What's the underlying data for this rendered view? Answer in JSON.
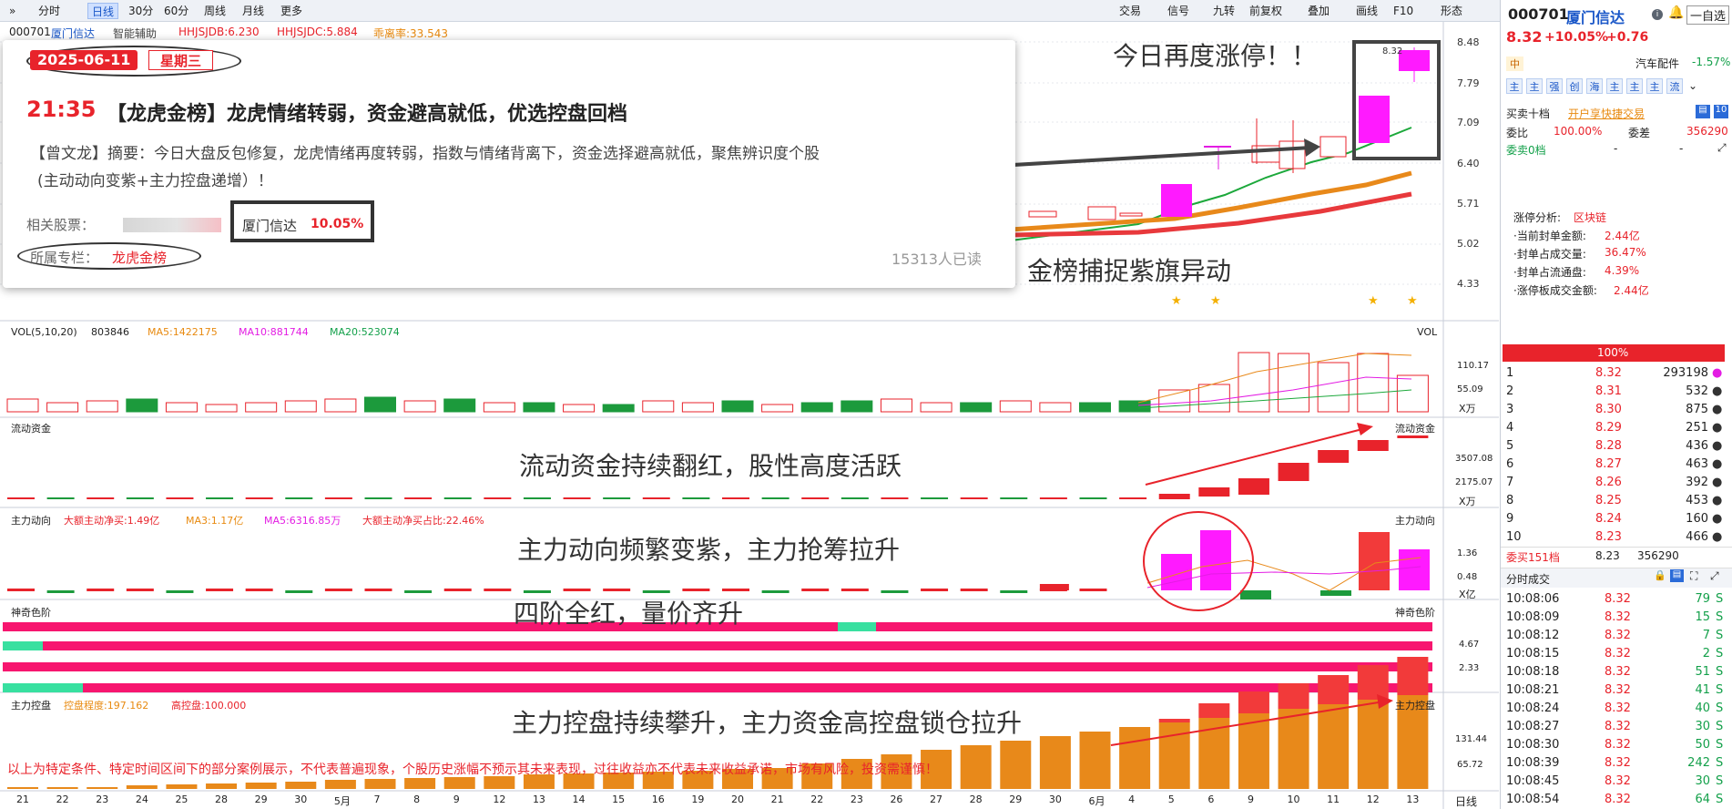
{
  "toolbar": {
    "items": [
      "»",
      "分时",
      "日线",
      "30分",
      "60分",
      "周线",
      "月线",
      "更多",
      "交易",
      "信号",
      "九转",
      "前复权",
      "叠加",
      "画线",
      "F10",
      "形态"
    ]
  },
  "header": {
    "code": "000701",
    "name": "厦门信达",
    "ind1": "HHJSJDB:6.230",
    "ind2": "HHJSJDC:5.884",
    "ind3": "乖离率:33.543",
    "assist": "智能辅助"
  },
  "price_axis": [
    "8.48",
    "7.79",
    "7.09",
    "6.40",
    "5.71",
    "5.02",
    "4.33"
  ],
  "news": {
    "date": "2025-06-11",
    "weekday": "星期三",
    "time": "21:35",
    "title": "【龙虎金榜】龙虎情绪转弱，资金避高就低，优选控盘回档",
    "summary1": "【曾文龙】摘要：今日大盘反包修复，龙虎情绪再度转弱，指数与情绪背离下，资金选择避高就低，聚焦辨识度个股",
    "summary2": "(主动动向变紫+主力控盘递增）！",
    "related_label": "相关股票：",
    "stock": "厦门信达",
    "stock_pct": "10.05%",
    "column_label": "所属专栏：",
    "column": "龙虎金榜",
    "reads": "15313人已读"
  },
  "annotations": {
    "a1": "今日再度涨停！！",
    "a2": "金榜捕捉紫旗异动",
    "a3": "流动资金持续翻红，股性高度活跃",
    "a4": "主力动向频繁变紫，主力抢筹拉升",
    "a5": "四阶全红，量价齐升",
    "a6": "主力控盘持续攀升，主力资金高控盘锁仓拉升",
    "disclaimer": "以上为特定条件、特定时间区间下的部分案例展示，不代表普遍现象，个股历史涨幅不预示其未来表现，过往收益亦不代表未来收益承诺，市场有风险，投资需谨慎！"
  },
  "vol": {
    "title": "VOL(5,10,20)",
    "val": "803846",
    "ma5": "MA5:1422175",
    "ma10": "MA10:881744",
    "ma20": "MA20:523074",
    "tag": "VOL",
    "axis": [
      "110.17",
      "55.09"
    ],
    "unit": "X万"
  },
  "flow": {
    "title": "流动资金",
    "tag": "流动资金",
    "axis": [
      "3507.08",
      "2175.07"
    ],
    "unit": "X万"
  },
  "main": {
    "title": "主力动向",
    "big": "大额主动净买:1.49亿",
    "ma3": "MA3:1.17亿",
    "ma5": "MA5:6316.85万",
    "ratio": "大额主动净买占比:22.46%",
    "tag": "主力动向",
    "axis": [
      "1.36",
      "0.48"
    ],
    "unit": "X亿"
  },
  "magic": {
    "title": "神奇色阶",
    "tag": "神奇色阶",
    "axis": [
      "4.67",
      "2.33"
    ]
  },
  "ctrl": {
    "title": "主力控盘",
    "deg": "控盘程度:197.162",
    "high": "高控盘:100.000",
    "tag": "主力控盘",
    "axis": [
      "131.44",
      "65.72"
    ]
  },
  "xaxis": [
    "21",
    "22",
    "23",
    "24",
    "25",
    "28",
    "29",
    "30",
    "5月",
    "7",
    "8",
    "9",
    "12",
    "13",
    "14",
    "15",
    "16",
    "19",
    "20",
    "21",
    "22",
    "23",
    "26",
    "27",
    "28",
    "29",
    "30",
    "6月",
    "4",
    "5",
    "6",
    "9",
    "10",
    "11",
    "12",
    "13"
  ],
  "xaxis_tag": "日线",
  "right": {
    "code": "000701",
    "name": "厦门信达",
    "price": "8.32",
    "pct": "+10.05%",
    "chg": "+0.76",
    "self": "一自选",
    "sector_tag": "中",
    "sector": "汽车配件",
    "sector_pct": "-1.57%",
    "tabs": [
      "主",
      "主",
      "强",
      "创",
      "海",
      "主",
      "主",
      "主",
      "流"
    ],
    "l10": "买卖十档",
    "open_btn": "开户享快捷交易",
    "wb_label": "委比",
    "wb": "100.00%",
    "wc_label": "委差",
    "wc": "356290",
    "ws0": "委卖0档",
    "ws_dash": "-",
    "ws_dash2": "-",
    "limit_title": "涨停分析:",
    "limit_val": "区块链",
    "seal_amt": "·当前封单金额:",
    "seal_amt_v": "2.44亿",
    "seal_vol": "·封单占成交量:",
    "seal_vol_v": "36.47%",
    "seal_flow": "·封单占流通盘:",
    "seal_flow_v": "4.39%",
    "limit_amt": "·涨停板成交金额:",
    "limit_amt_v": "2.44亿",
    "pct100": "100%",
    "book": [
      [
        "1",
        "8.32",
        "293198"
      ],
      [
        "2",
        "8.31",
        "532"
      ],
      [
        "3",
        "8.30",
        "875"
      ],
      [
        "4",
        "8.29",
        "251"
      ],
      [
        "5",
        "8.28",
        "436"
      ],
      [
        "6",
        "8.27",
        "463"
      ],
      [
        "7",
        "8.26",
        "392"
      ],
      [
        "8",
        "8.25",
        "453"
      ],
      [
        "9",
        "8.24",
        "160"
      ],
      [
        "10",
        "8.23",
        "466"
      ]
    ],
    "wm_label": "委买151档",
    "wm_price": "8.23",
    "wm_vol": "356290",
    "ticks_title": "分时成交",
    "ticks": [
      [
        "10:08:06",
        "8.32",
        "79",
        "S"
      ],
      [
        "10:08:09",
        "8.32",
        "15",
        "S"
      ],
      [
        "10:08:12",
        "8.32",
        "7",
        "S"
      ],
      [
        "10:08:15",
        "8.32",
        "2",
        "S"
      ],
      [
        "10:08:18",
        "8.32",
        "51",
        "S"
      ],
      [
        "10:08:21",
        "8.32",
        "41",
        "S"
      ],
      [
        "10:08:24",
        "8.32",
        "40",
        "S"
      ],
      [
        "10:08:27",
        "8.32",
        "30",
        "S"
      ],
      [
        "10:08:30",
        "8.32",
        "50",
        "S"
      ],
      [
        "10:08:39",
        "8.32",
        "242",
        "S"
      ],
      [
        "10:08:45",
        "8.32",
        "30",
        "S"
      ],
      [
        "10:08:54",
        "8.32",
        "64",
        "S"
      ]
    ]
  }
}
